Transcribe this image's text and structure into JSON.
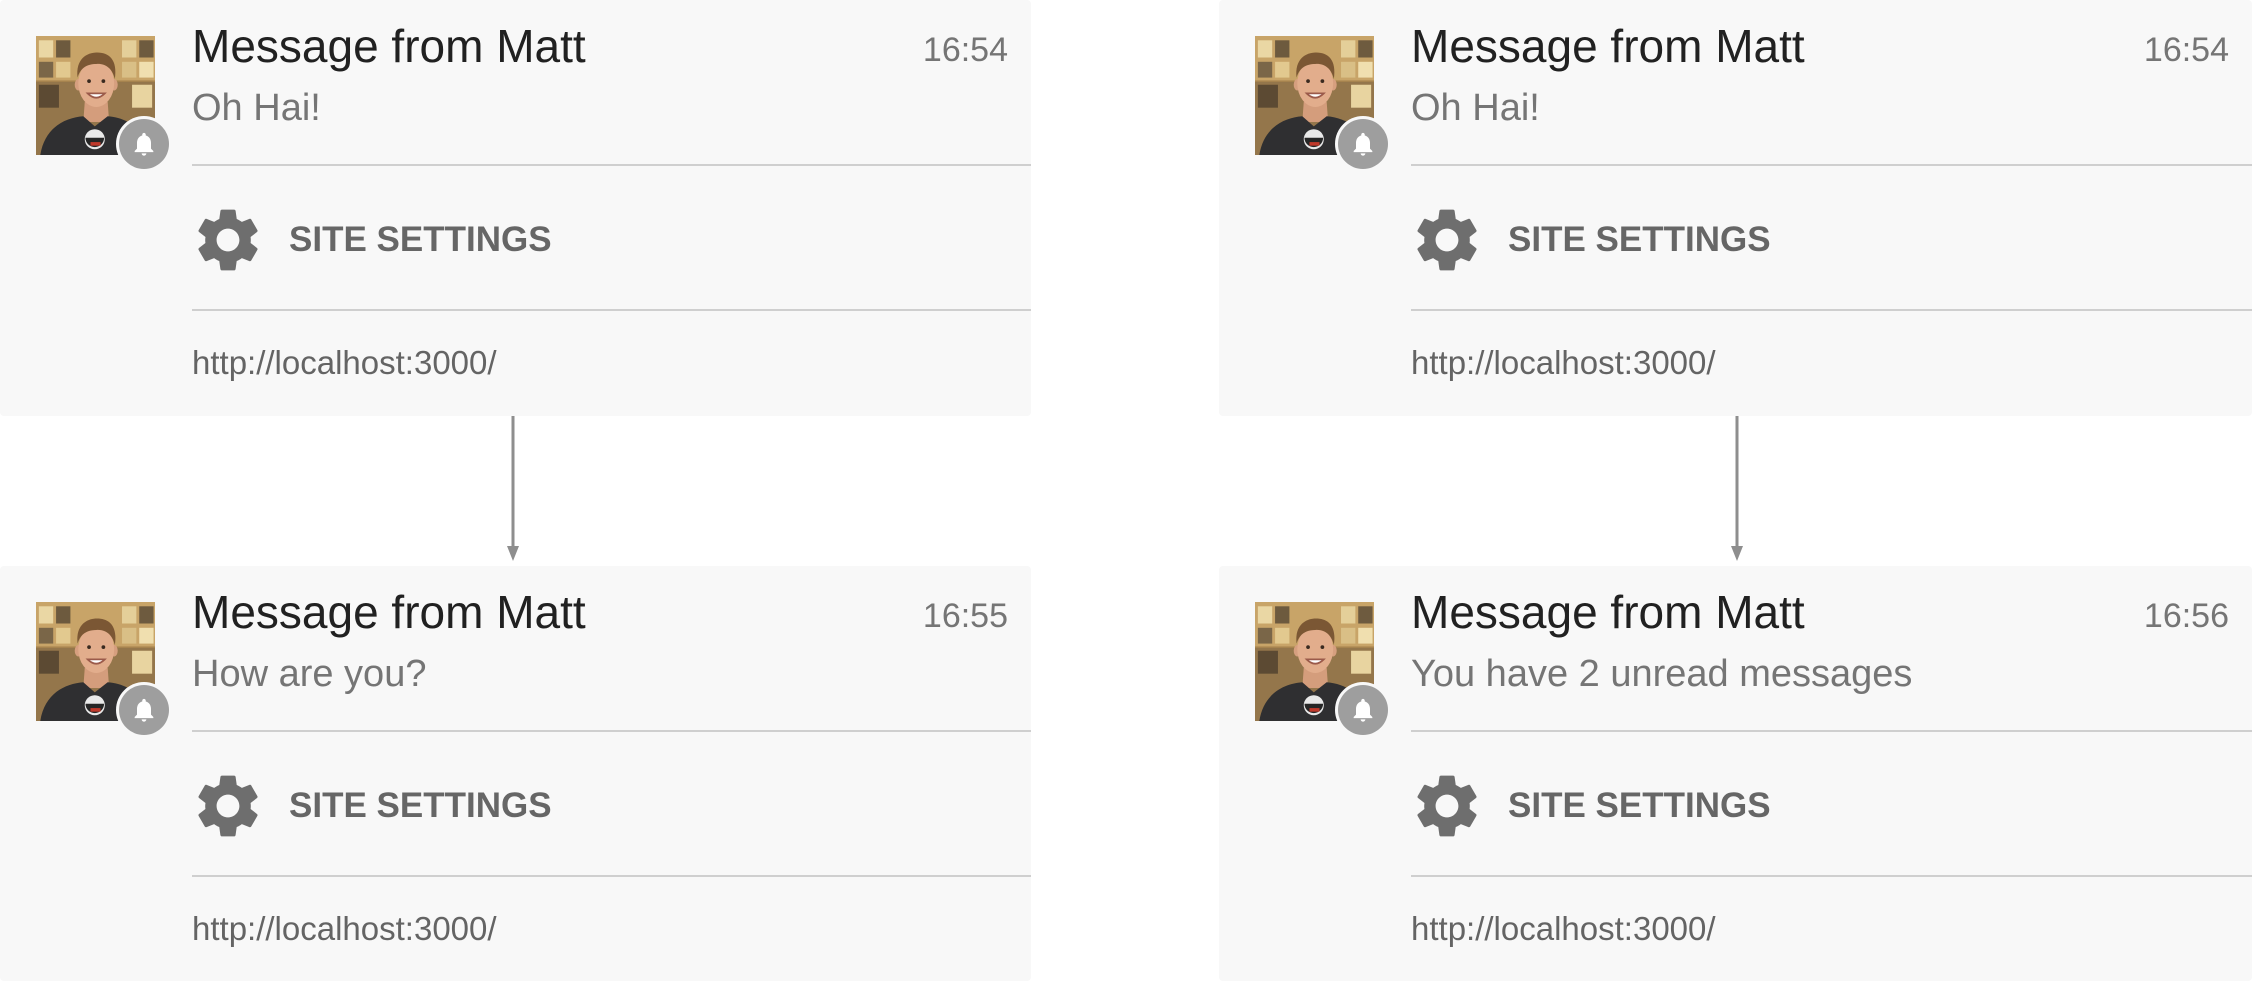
{
  "flows": [
    {
      "before": {
        "title": "Message from Matt",
        "time": "16:54",
        "body": "Oh Hai!",
        "action_label": "SITE SETTINGS",
        "origin": "http://localhost:3000/"
      },
      "after": {
        "title": "Message from Matt",
        "time": "16:55",
        "body": "How are you?",
        "action_label": "SITE SETTINGS",
        "origin": "http://localhost:3000/"
      }
    },
    {
      "before": {
        "title": "Message from Matt",
        "time": "16:54",
        "body": "Oh Hai!",
        "action_label": "SITE SETTINGS",
        "origin": "http://localhost:3000/"
      },
      "after": {
        "title": "Message from Matt",
        "time": "16:56",
        "body": "You have 2 unread messages",
        "action_label": "SITE SETTINGS",
        "origin": "http://localhost:3000/"
      }
    }
  ],
  "icons": {
    "action": "gear-icon",
    "badge": "bell-icon",
    "transition": "arrow-down-icon",
    "sender": "avatar"
  },
  "colors": {
    "card_background": "#f8f8f8",
    "title": "#212121",
    "secondary_text": "#757575",
    "action_text": "#666666",
    "origin_text": "#646464",
    "icon": "#6e6e6e",
    "divider": "#cfcfcf",
    "badge": "#9e9e9e",
    "arrow": "#8e8e8e"
  }
}
